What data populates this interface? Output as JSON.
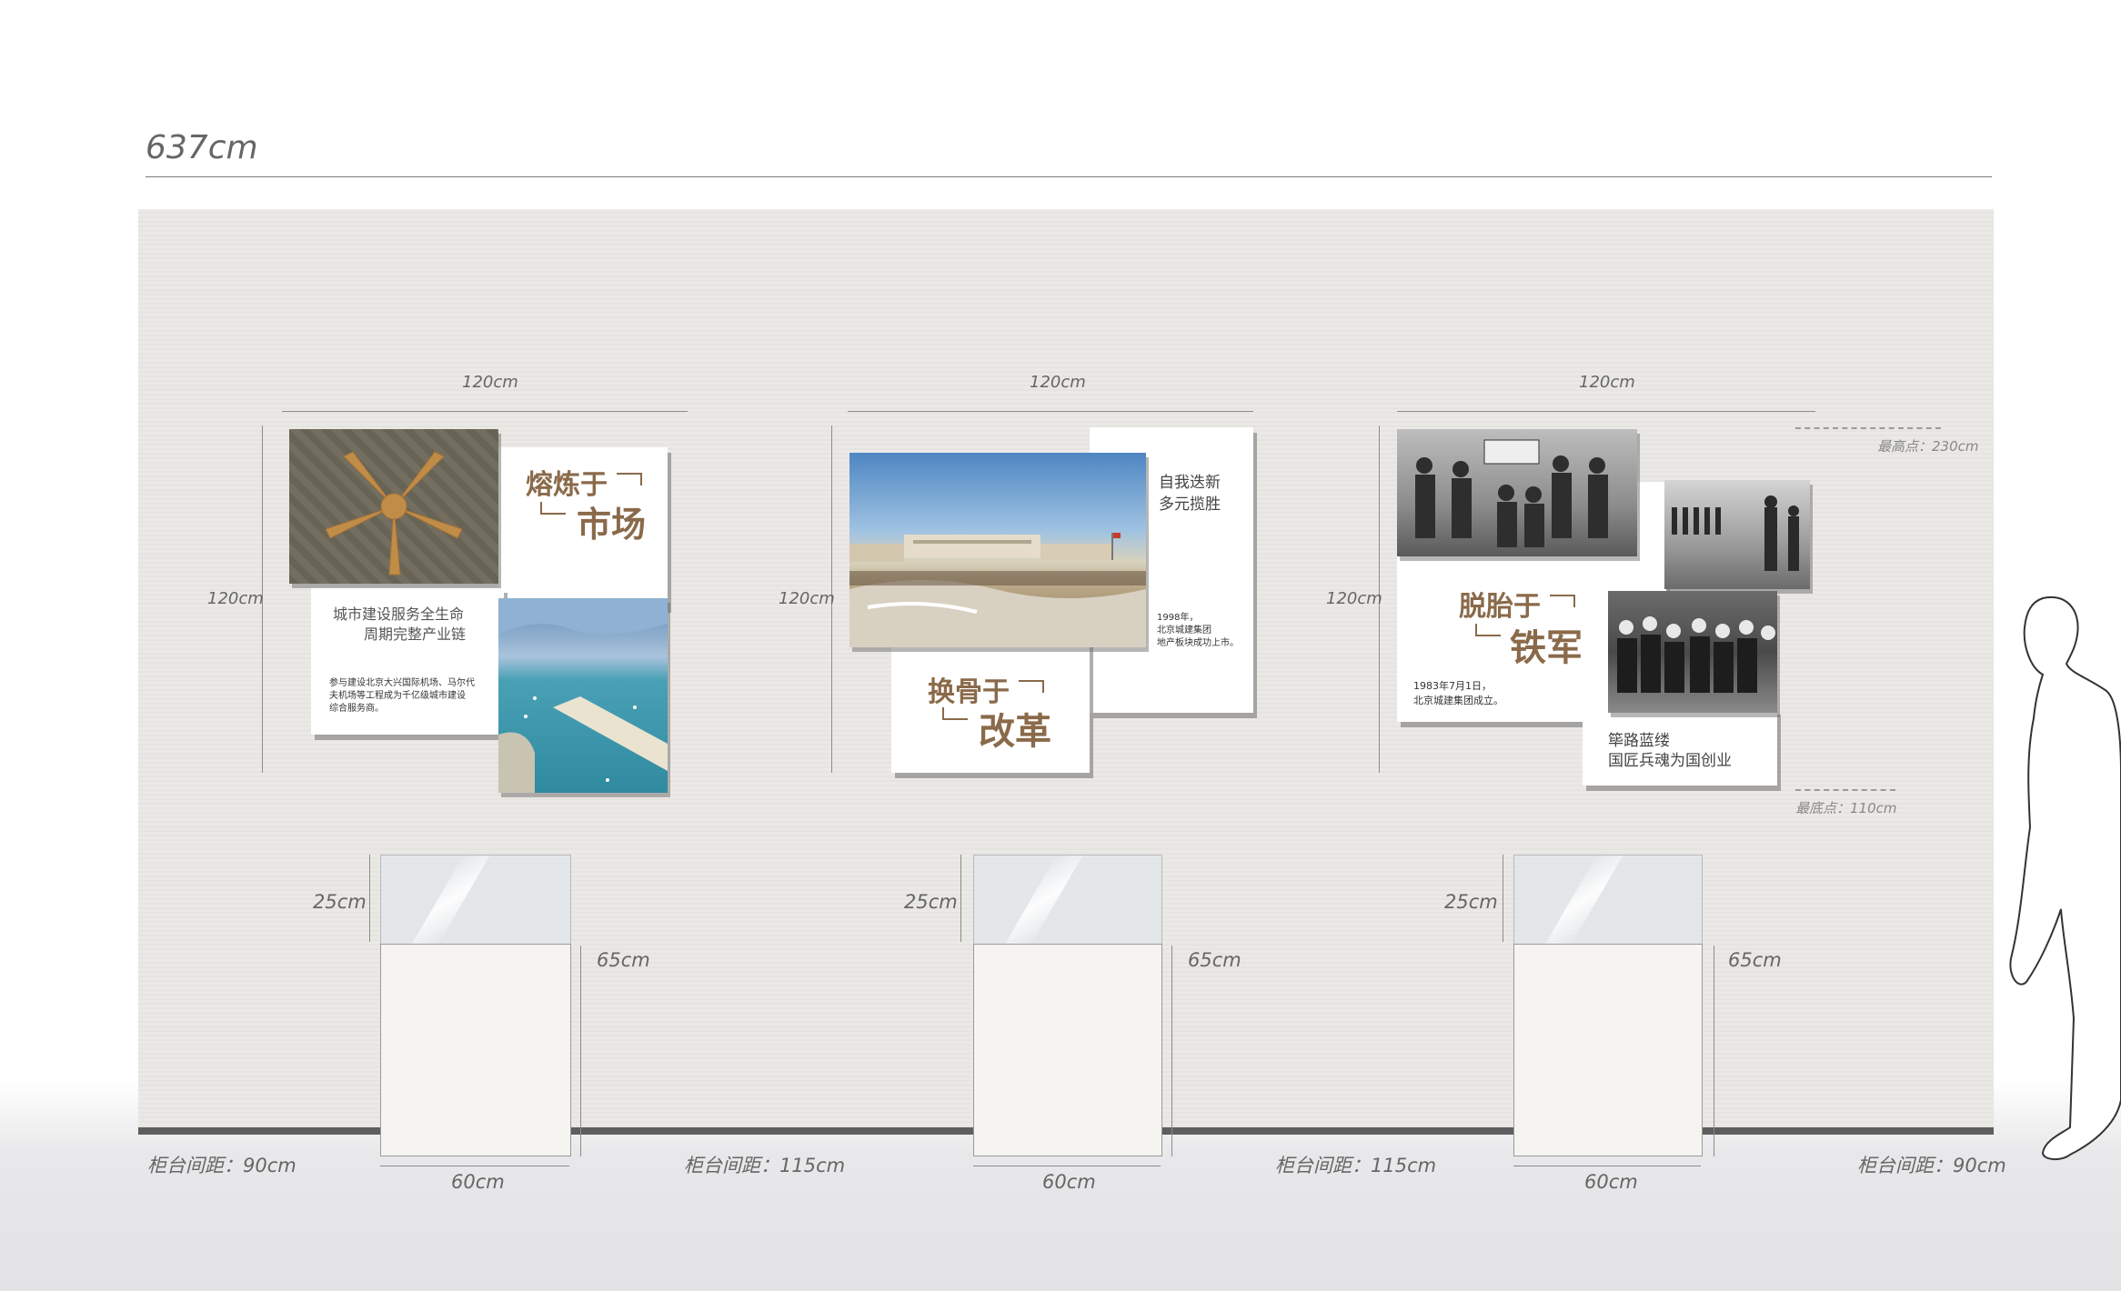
{
  "overall_width": "637cm",
  "panel_width_label": "120cm",
  "panel_height_label": "120cm",
  "top_point": "最高点：230cm",
  "bottom_point": "最底点：110cm",
  "case_glass_height": "25cm",
  "case_body_height": "65cm",
  "case_width": "60cm",
  "spacing": {
    "left": "柜台间距：90cm",
    "middle1": "柜台间距：115cm",
    "middle2": "柜台间距：115cm",
    "right": "柜台间距：90cm"
  },
  "panel1": {
    "title_top": "熔炼于",
    "title_bottom": "市场",
    "subtitle_line1": "城市建设服务全生命",
    "subtitle_line2": "周期完整产业链",
    "body_line1": "参与建设北京大兴国际机场、马尔代",
    "body_line2": "夫机场等工程成为千亿级城市建设",
    "body_line3": "综合服务商。"
  },
  "panel2": {
    "title_top": "换骨于",
    "title_bottom": "改革",
    "note_line1": "自我迭新",
    "note_line2": "多元揽胜",
    "body_line1": "1998年，",
    "body_line2": "北京城建集团",
    "body_line3": "地产板块成功上市。"
  },
  "panel3": {
    "title_top": "脱胎于",
    "title_bottom": "铁军",
    "body_line1": "1983年7月1日，",
    "body_line2": "北京城建集团成立。",
    "caption_line1": "筚路蓝缕",
    "caption_line2": "国匠兵魂为国创业"
  },
  "colors": {
    "accent_brown": "#8a6a4a",
    "wall": "#ebe9e5",
    "baseline": "#5e5e5e"
  }
}
